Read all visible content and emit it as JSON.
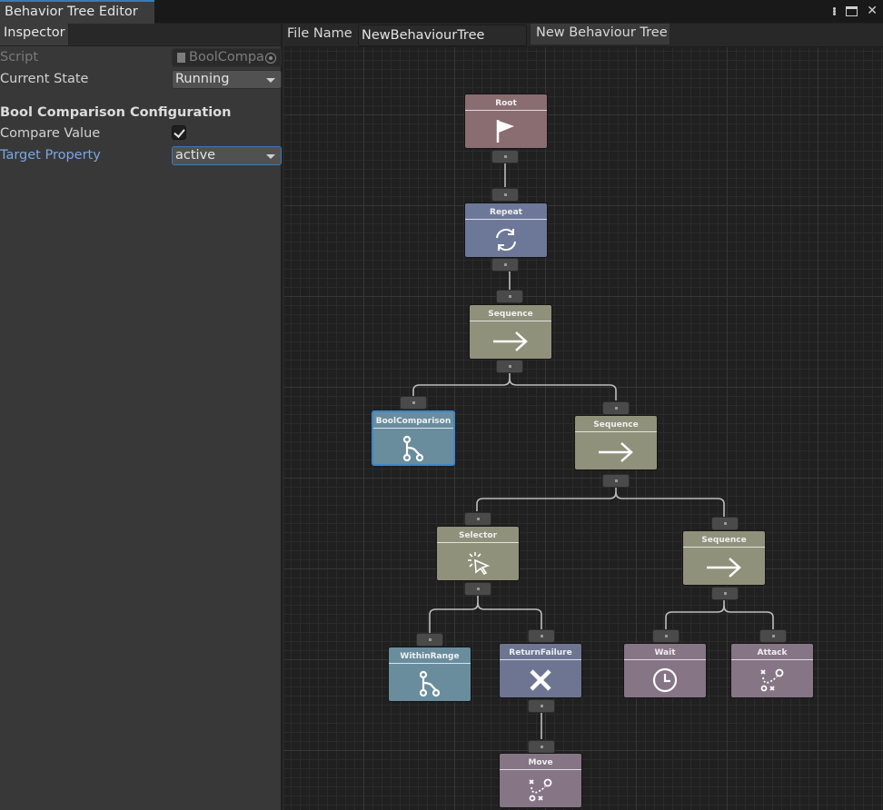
{
  "window": {
    "tab_title": "Behavior Tree Editor"
  },
  "inspector": {
    "tab_label": "Inspector",
    "script_label": "Script",
    "script_value": "BoolCompa",
    "current_state_label": "Current State",
    "current_state_value": "Running",
    "section_title": "Bool Comparison Configuration",
    "compare_value_label": "Compare Value",
    "compare_value_checked": true,
    "target_property_label": "Target Property",
    "target_property_value": "active"
  },
  "toolbar": {
    "file_name_label": "File Name",
    "file_name_value": "NewBehaviourTree",
    "tree_tab_label": "New Behaviour Tree"
  },
  "colors": {
    "root": "#8a6d70",
    "repeat": "#6d7899",
    "sequence": "#8f917b",
    "condition": "#6a8d9e",
    "return_failure": "#6d7592",
    "action": "#857585",
    "selection": "#3f86c8"
  },
  "nodes": [
    {
      "id": "root",
      "label": "Root",
      "icon": "flag-icon"
    },
    {
      "id": "repeat",
      "label": "Repeat",
      "icon": "repeat-icon"
    },
    {
      "id": "sequence1",
      "label": "Sequence",
      "icon": "arrow-right-icon"
    },
    {
      "id": "boolcomparison",
      "label": "BoolComparison",
      "icon": "branch-icon",
      "selected": true
    },
    {
      "id": "sequence2",
      "label": "Sequence",
      "icon": "arrow-right-icon"
    },
    {
      "id": "selector",
      "label": "Selector",
      "icon": "cursor-click-icon"
    },
    {
      "id": "sequence3",
      "label": "Sequence",
      "icon": "arrow-right-icon"
    },
    {
      "id": "withinrange",
      "label": "WithinRange",
      "icon": "branch-icon"
    },
    {
      "id": "returnfailure",
      "label": "ReturnFailure",
      "icon": "x-icon"
    },
    {
      "id": "wait",
      "label": "Wait",
      "icon": "clock-icon"
    },
    {
      "id": "attack",
      "label": "Attack",
      "icon": "path-icon"
    },
    {
      "id": "move",
      "label": "Move",
      "icon": "path-icon"
    }
  ]
}
